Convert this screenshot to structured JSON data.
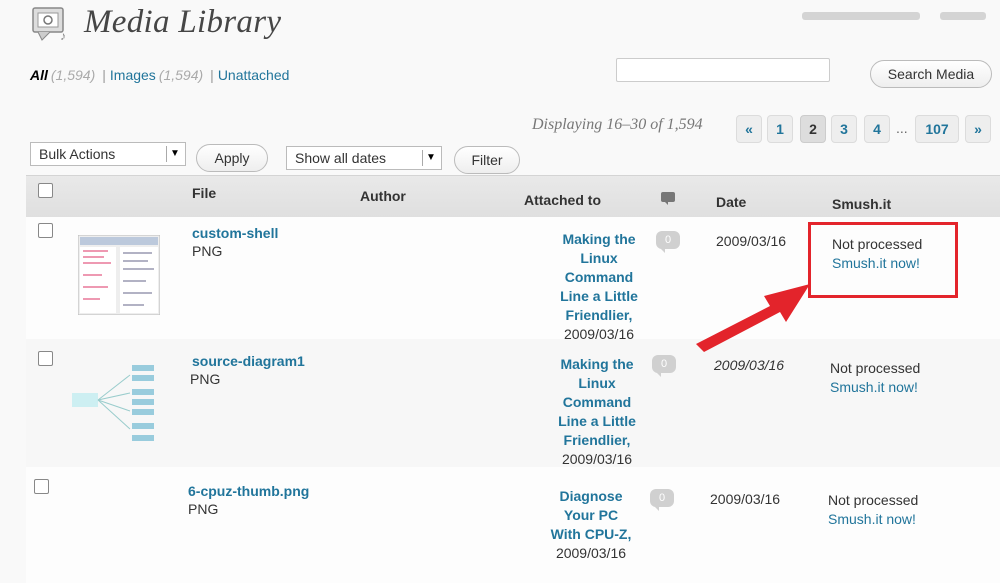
{
  "page": {
    "title": "Media Library"
  },
  "filters": {
    "all_label": "All",
    "all_count": "(1,594)",
    "images_label": "Images",
    "images_count": "(1,594)",
    "unattached_label": "Unattached",
    "sep": "|"
  },
  "search": {
    "button_label": "Search Media",
    "value": ""
  },
  "pagination": {
    "displaying": "Displaying 16–30 of 1,594",
    "prev": "«",
    "pages": [
      "1",
      "2",
      "3",
      "4"
    ],
    "ellipsis": "...",
    "last": "107",
    "next": "»",
    "current_page": "2"
  },
  "controls": {
    "bulk_actions": "Bulk Actions",
    "apply": "Apply",
    "dates": "Show all dates",
    "filter": "Filter"
  },
  "table": {
    "headers": {
      "file": "File",
      "author": "Author",
      "attached": "Attached to",
      "date": "Date",
      "smush": "Smush.it"
    },
    "rows": [
      {
        "file": "custom-shell",
        "type": "PNG",
        "attached_lines": [
          "Making the",
          "Linux",
          "Command",
          "Line a Little",
          "Friendlier,"
        ],
        "attached_date": "2009/03/16",
        "comments": "0",
        "date": "2009/03/16",
        "status": "Not processed",
        "action_a": "Smush.it",
        "action_b": "now!"
      },
      {
        "file": "source-diagram1",
        "type": "PNG",
        "attached_lines": [
          "Making the",
          "Linux",
          "Command",
          "Line a Little",
          "Friendlier,"
        ],
        "attached_date": "2009/03/16",
        "comments": "0",
        "date": "2009/03/16",
        "status": "Not processed",
        "action_a": "Smush.it",
        "action_b": "now!"
      },
      {
        "file": "6-cpuz-thumb.png",
        "type": "PNG",
        "attached_lines": [
          "Diagnose",
          "Your PC",
          "With CPU-Z,"
        ],
        "attached_date": "2009/03/16",
        "comments": "0",
        "date": "2009/03/16",
        "status": "Not processed",
        "action_a": "Smush.it",
        "action_b": "now!"
      }
    ]
  },
  "colors": {
    "link": "#21759b",
    "annotation": "#e3242b"
  },
  "icons": {
    "page": "media-library-icon",
    "comment": "comment-bubble-icon",
    "arrow": "red-annotation-arrow"
  }
}
